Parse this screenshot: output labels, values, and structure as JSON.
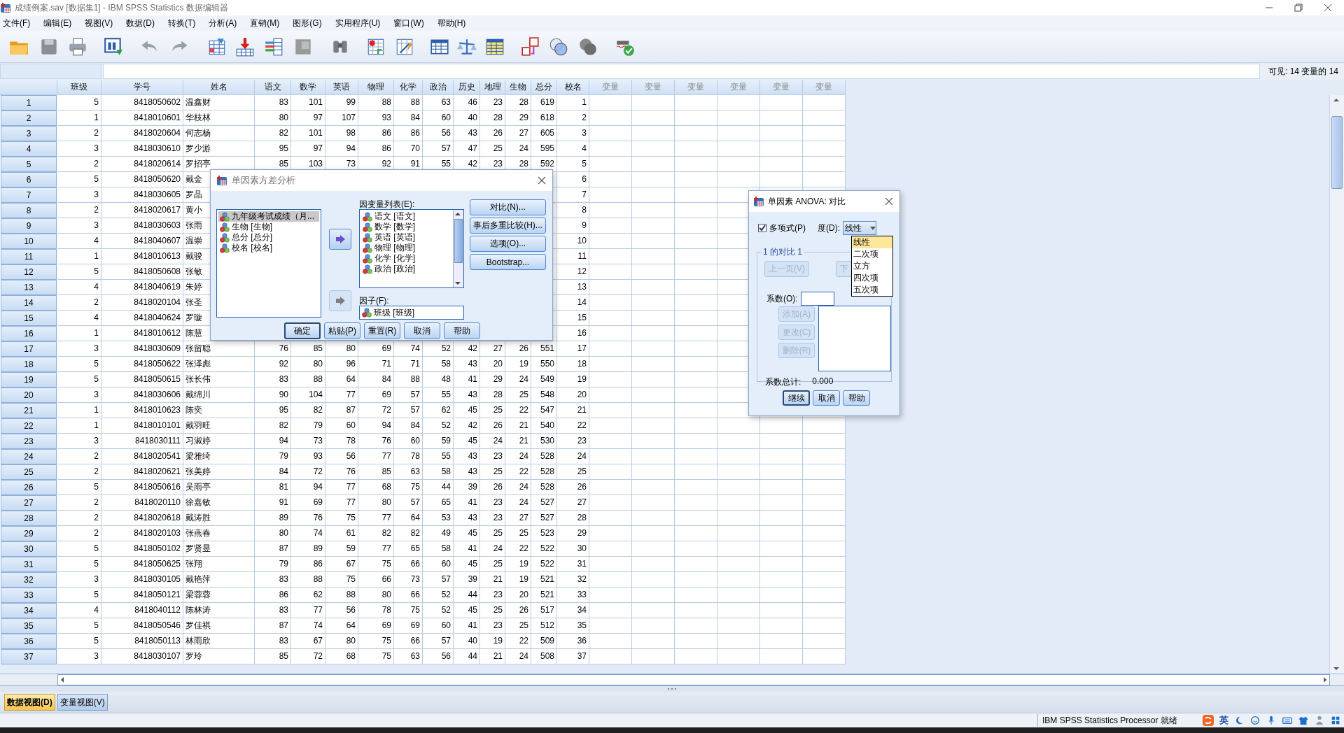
{
  "window": {
    "title": "成绩例案.sav [数据集1] - IBM SPSS Statistics 数据编辑器"
  },
  "menu": [
    "文件(F)",
    "编辑(E)",
    "视图(V)",
    "数据(D)",
    "转换(T)",
    "分析(A)",
    "直销(M)",
    "图形(G)",
    "实用程序(U)",
    "窗口(W)",
    "帮助(H)"
  ],
  "cell_editor": {
    "variables_visible": "可见: 14 变量的 14"
  },
  "table": {
    "columns": [
      {
        "label": "班级",
        "kind": "variable"
      },
      {
        "label": "学号",
        "kind": "variable"
      },
      {
        "label": "姓名",
        "kind": "variable"
      },
      {
        "label": "语文",
        "kind": "variable"
      },
      {
        "label": "数学",
        "kind": "variable"
      },
      {
        "label": "英语",
        "kind": "variable"
      },
      {
        "label": "物理",
        "kind": "variable"
      },
      {
        "label": "化学",
        "kind": "variable"
      },
      {
        "label": "政治",
        "kind": "variable"
      },
      {
        "label": "历史",
        "kind": "variable"
      },
      {
        "label": "地理",
        "kind": "variable"
      },
      {
        "label": "生物",
        "kind": "variable"
      },
      {
        "label": "总分",
        "kind": "variable"
      },
      {
        "label": "校名",
        "kind": "variable"
      },
      {
        "label": "变量",
        "kind": "placeholder"
      },
      {
        "label": "变量",
        "kind": "placeholder"
      },
      {
        "label": "变量",
        "kind": "placeholder"
      },
      {
        "label": "变量",
        "kind": "placeholder"
      },
      {
        "label": "变量",
        "kind": "placeholder"
      },
      {
        "label": "变量",
        "kind": "placeholder"
      }
    ],
    "rows": [
      {
        "number": "1",
        "cells": [
          "5",
          "8418050602",
          "温鑫财",
          "83",
          "101",
          "99",
          "88",
          "88",
          "63",
          "46",
          "23",
          "28",
          "619",
          "1"
        ]
      },
      {
        "number": "2",
        "cells": [
          "1",
          "8418010601",
          "华枝林",
          "80",
          "97",
          "107",
          "93",
          "84",
          "60",
          "40",
          "28",
          "29",
          "618",
          "2"
        ]
      },
      {
        "number": "3",
        "cells": [
          "2",
          "8418020604",
          "何志杨",
          "82",
          "101",
          "98",
          "86",
          "86",
          "56",
          "43",
          "26",
          "27",
          "605",
          "3"
        ]
      },
      {
        "number": "4",
        "cells": [
          "3",
          "8418030610",
          "罗少游",
          "95",
          "97",
          "94",
          "86",
          "70",
          "57",
          "47",
          "25",
          "24",
          "595",
          "4"
        ]
      },
      {
        "number": "5",
        "cells": [
          "2",
          "8418020614",
          "罗招亭",
          "85",
          "103",
          "73",
          "92",
          "91",
          "55",
          "42",
          "23",
          "28",
          "592",
          "5"
        ]
      },
      {
        "number": "6",
        "cells": [
          "5",
          "8418050620",
          "戴金",
          null,
          null,
          null,
          null,
          null,
          null,
          null,
          null,
          null,
          null,
          "6"
        ]
      },
      {
        "number": "7",
        "cells": [
          "3",
          "8418030605",
          "罗晶",
          null,
          null,
          null,
          null,
          null,
          null,
          null,
          null,
          null,
          null,
          "7"
        ]
      },
      {
        "number": "8",
        "cells": [
          "2",
          "8418020617",
          "黄小",
          null,
          null,
          null,
          null,
          null,
          null,
          null,
          null,
          null,
          null,
          "8"
        ]
      },
      {
        "number": "9",
        "cells": [
          "3",
          "8418030603",
          "张雨",
          null,
          null,
          null,
          null,
          null,
          null,
          null,
          null,
          null,
          null,
          "9"
        ]
      },
      {
        "number": "10",
        "cells": [
          "4",
          "8418040607",
          "温崇",
          null,
          null,
          null,
          null,
          null,
          null,
          null,
          null,
          null,
          null,
          "10"
        ]
      },
      {
        "number": "11",
        "cells": [
          "1",
          "8418010613",
          "戴骏",
          null,
          null,
          null,
          null,
          null,
          null,
          null,
          null,
          null,
          null,
          "11"
        ]
      },
      {
        "number": "12",
        "cells": [
          "5",
          "8418050608",
          "张敏",
          null,
          null,
          null,
          null,
          null,
          null,
          null,
          null,
          null,
          null,
          "12"
        ]
      },
      {
        "number": "13",
        "cells": [
          "4",
          "8418040619",
          "朱婷",
          null,
          null,
          null,
          null,
          null,
          null,
          null,
          null,
          null,
          null,
          "13"
        ]
      },
      {
        "number": "14",
        "cells": [
          "2",
          "8418020104",
          "张圣",
          null,
          null,
          null,
          null,
          null,
          null,
          null,
          null,
          null,
          null,
          "14"
        ]
      },
      {
        "number": "15",
        "cells": [
          "4",
          "8418040624",
          "罗璇",
          null,
          null,
          null,
          null,
          null,
          null,
          null,
          null,
          null,
          null,
          "15"
        ]
      },
      {
        "number": "16",
        "cells": [
          "1",
          "8418010612",
          "陈慧",
          null,
          null,
          null,
          null,
          null,
          null,
          null,
          null,
          null,
          null,
          "16"
        ]
      },
      {
        "number": "17",
        "cells": [
          "3",
          "8418030609",
          "张留聪",
          "76",
          "85",
          "80",
          "69",
          "74",
          "52",
          "42",
          "27",
          "26",
          "551",
          "17"
        ]
      },
      {
        "number": "18",
        "cells": [
          "5",
          "8418050622",
          "张泽彪",
          "92",
          "80",
          "96",
          "71",
          "71",
          "58",
          "43",
          "20",
          "19",
          "550",
          "18"
        ]
      },
      {
        "number": "19",
        "cells": [
          "5",
          "8418050615",
          "张长伟",
          "83",
          "88",
          "64",
          "84",
          "88",
          "48",
          "41",
          "29",
          "24",
          "549",
          "19"
        ]
      },
      {
        "number": "20",
        "cells": [
          "3",
          "8418030606",
          "戴绵川",
          "90",
          "104",
          "77",
          "69",
          "57",
          "55",
          "43",
          "28",
          "25",
          "548",
          "20"
        ]
      },
      {
        "number": "21",
        "cells": [
          "1",
          "8418010623",
          "陈奕",
          "95",
          "82",
          "87",
          "72",
          "57",
          "62",
          "45",
          "25",
          "22",
          "547",
          "21"
        ]
      },
      {
        "number": "22",
        "cells": [
          "1",
          "8418010101",
          "戴羽旺",
          "82",
          "79",
          "60",
          "94",
          "84",
          "52",
          "42",
          "26",
          "21",
          "540",
          "22"
        ]
      },
      {
        "number": "23",
        "cells": [
          "3",
          "8418030111",
          "习淑婷",
          "94",
          "73",
          "78",
          "76",
          "60",
          "59",
          "45",
          "24",
          "21",
          "530",
          "23"
        ]
      },
      {
        "number": "24",
        "cells": [
          "2",
          "8418020541",
          "梁雅绮",
          "79",
          "93",
          "56",
          "77",
          "78",
          "55",
          "43",
          "23",
          "24",
          "528",
          "24"
        ]
      },
      {
        "number": "25",
        "cells": [
          "2",
          "8418020621",
          "张美婷",
          "84",
          "72",
          "76",
          "85",
          "63",
          "58",
          "43",
          "25",
          "22",
          "528",
          "25"
        ]
      },
      {
        "number": "26",
        "cells": [
          "5",
          "8418050616",
          "吴雨亭",
          "81",
          "94",
          "77",
          "68",
          "75",
          "44",
          "39",
          "26",
          "24",
          "528",
          "26"
        ]
      },
      {
        "number": "27",
        "cells": [
          "2",
          "8418020110",
          "徐嘉敏",
          "91",
          "69",
          "77",
          "80",
          "57",
          "65",
          "41",
          "23",
          "24",
          "527",
          "27"
        ]
      },
      {
        "number": "28",
        "cells": [
          "2",
          "8418020618",
          "戴涛胜",
          "89",
          "76",
          "75",
          "77",
          "64",
          "53",
          "43",
          "23",
          "27",
          "527",
          "28"
        ]
      },
      {
        "number": "29",
        "cells": [
          "2",
          "8418020103",
          "张燕春",
          "80",
          "74",
          "61",
          "82",
          "82",
          "49",
          "45",
          "25",
          "25",
          "523",
          "29"
        ]
      },
      {
        "number": "30",
        "cells": [
          "5",
          "8418050102",
          "罗贤昱",
          "87",
          "89",
          "59",
          "77",
          "65",
          "58",
          "41",
          "24",
          "22",
          "522",
          "30"
        ]
      },
      {
        "number": "31",
        "cells": [
          "5",
          "8418050625",
          "张翔",
          "79",
          "86",
          "67",
          "75",
          "66",
          "60",
          "45",
          "25",
          "19",
          "522",
          "31"
        ]
      },
      {
        "number": "32",
        "cells": [
          "3",
          "8418030105",
          "戴艳萍",
          "83",
          "88",
          "75",
          "66",
          "73",
          "57",
          "39",
          "21",
          "19",
          "521",
          "32"
        ]
      },
      {
        "number": "33",
        "cells": [
          "5",
          "8418050121",
          "梁蓉蓉",
          "86",
          "62",
          "88",
          "80",
          "66",
          "52",
          "44",
          "23",
          "20",
          "521",
          "33"
        ]
      },
      {
        "number": "34",
        "cells": [
          "4",
          "8418040112",
          "陈林涛",
          "83",
          "77",
          "56",
          "78",
          "75",
          "52",
          "45",
          "25",
          "26",
          "517",
          "34"
        ]
      },
      {
        "number": "35",
        "cells": [
          "5",
          "8418050546",
          "罗佳祺",
          "87",
          "74",
          "64",
          "69",
          "69",
          "60",
          "41",
          "23",
          "25",
          "512",
          "35"
        ]
      },
      {
        "number": "36",
        "cells": [
          "5",
          "8418050113",
          "林雨欣",
          "83",
          "67",
          "80",
          "75",
          "66",
          "57",
          "40",
          "19",
          "22",
          "509",
          "36"
        ]
      },
      {
        "number": "37",
        "cells": [
          "3",
          "8418030107",
          "罗玲",
          "85",
          "72",
          "68",
          "75",
          "63",
          "56",
          "44",
          "21",
          "24",
          "508",
          "37"
        ]
      }
    ]
  },
  "anova_dialog": {
    "title": "单因素方差分析",
    "source_list": [
      {
        "label": "九年级考试成绩（月...",
        "selected": true
      },
      {
        "label": "生物 [生物]",
        "selected": false
      },
      {
        "label": "总分 [总分]",
        "selected": false
      },
      {
        "label": "校名 [校名]",
        "selected": false
      }
    ],
    "move_buttons": [
      {
        "disabled": false
      },
      {
        "disabled": true
      }
    ],
    "dependent_label": "因变量列表(E):",
    "dependent_list": [
      "语文 [语文]",
      "数学 [数学]",
      "英语 [英语]",
      "物理 [物理]",
      "化学 [化学]",
      "政治 [政治]"
    ],
    "factor_label": "因子(F):",
    "factor": "班级 [班级]",
    "side_buttons": [
      "对比(N)...",
      "事后多重比较(H)...",
      "选项(O)...",
      "Bootstrap..."
    ],
    "buttons": [
      {
        "label": "确定",
        "default": true
      },
      {
        "label": "粘贴(P)",
        "default": false
      },
      {
        "label": "重置(R)",
        "default": false
      },
      {
        "label": "取消",
        "default": false
      },
      {
        "label": "帮助",
        "default": false
      }
    ]
  },
  "contrast_dialog": {
    "title": "单因素 ANOVA: 对比",
    "polynomial": {
      "label": "多项式(P)",
      "checked": true
    },
    "degree": {
      "label": "度(D):",
      "value": "线性",
      "expanded": true,
      "options": [
        {
          "label": "线性",
          "selected": true
        },
        {
          "label": "二次项",
          "selected": false
        },
        {
          "label": "立方",
          "selected": false
        },
        {
          "label": "四次项",
          "selected": false
        },
        {
          "label": "五次项",
          "selected": false
        }
      ]
    },
    "group_label": "1 的对比 1",
    "nav_buttons": [
      {
        "label": "上一页(V)",
        "disabled": true
      },
      {
        "label": "下",
        "disabled": true
      }
    ],
    "coefficient_label": "系数(O):",
    "edit_buttons": [
      {
        "label": "添加(A)",
        "disabled": true
      },
      {
        "label": "更改(C)",
        "disabled": true
      },
      {
        "label": "删除(R)",
        "disabled": true
      }
    ],
    "total": {
      "label": "系数总计:",
      "value": "0.000"
    },
    "buttons": [
      {
        "label": "继续",
        "default": true
      },
      {
        "label": "取消",
        "default": false
      },
      {
        "label": "帮助",
        "default": false
      }
    ]
  },
  "view_tabs": [
    {
      "label": "数据视图(D)",
      "selected": true
    },
    {
      "label": "变量视图(V)",
      "selected": false
    }
  ],
  "status_bar": {
    "text": "IBM SPSS Statistics Processor 就绪",
    "ime": "英"
  }
}
